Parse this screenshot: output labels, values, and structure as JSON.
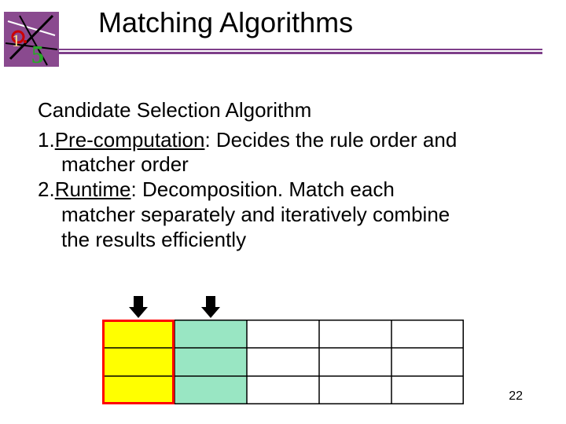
{
  "title": "Matching Algorithms",
  "subtitle": "Candidate Selection Algorithm",
  "items": [
    {
      "num": "1.",
      "term": "Pre-computation",
      "rest1": ": Decides the rule order and",
      "rest2": "matcher order"
    },
    {
      "num": "2.",
      "term": "Runtime",
      "rest1": ": Decomposition. Match each",
      "rest2": "matcher separately and iteratively combine",
      "rest3": "the results efficiently"
    }
  ],
  "table": {
    "cols": 5,
    "rows": 3,
    "highlight_cols": [
      {
        "index": 0,
        "fill": "#ffff00",
        "border": "#ff0000"
      },
      {
        "index": 1,
        "fill": "#99e6c3",
        "border": "none"
      }
    ]
  },
  "page_number": "22"
}
